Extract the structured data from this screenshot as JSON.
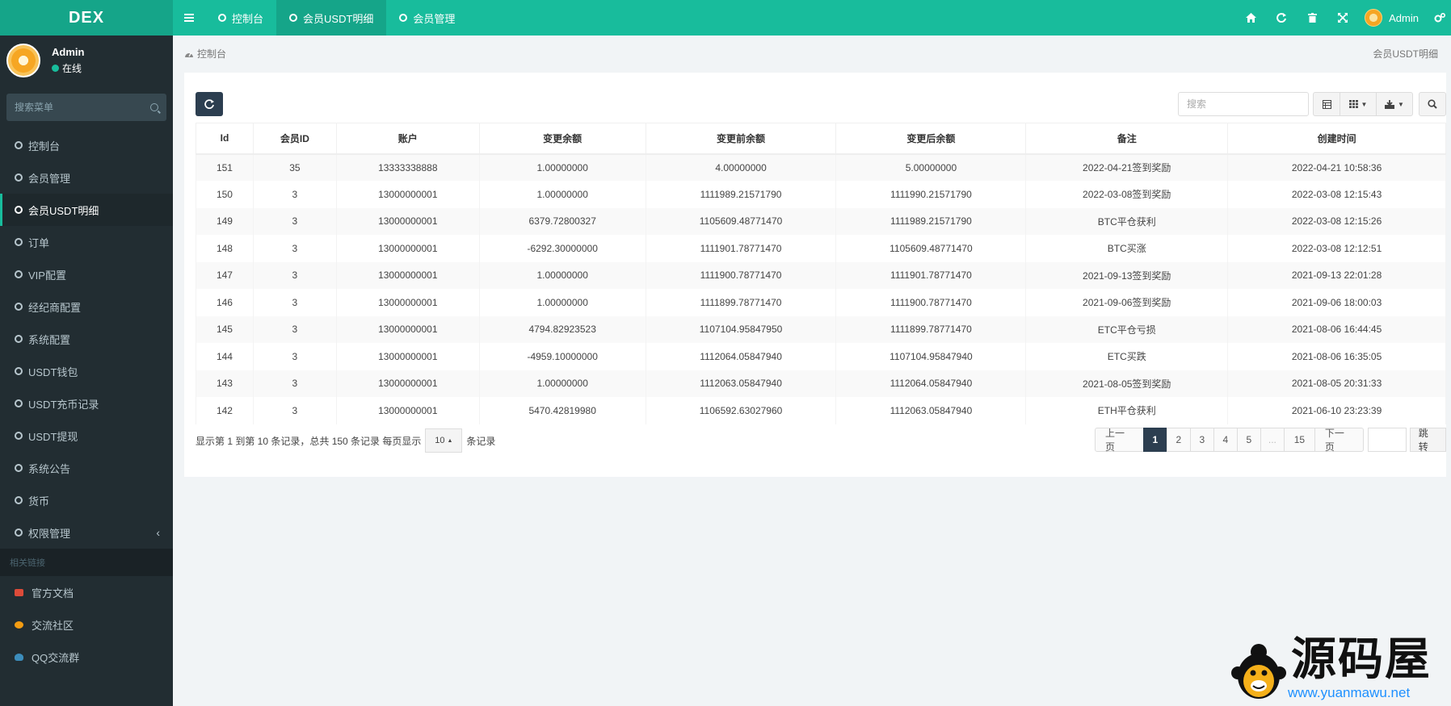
{
  "app": {
    "logo": "DEX"
  },
  "topnav": {
    "tabs": [
      {
        "label": "控制台",
        "active": false
      },
      {
        "label": "会员USDT明细",
        "active": true
      },
      {
        "label": "会员管理",
        "active": false
      }
    ],
    "user": "Admin",
    "icons": [
      "home-icon",
      "refresh-icon",
      "trash-icon",
      "fullscreen-icon",
      "settings-icon"
    ]
  },
  "sidebar": {
    "user_name": "Admin",
    "user_status": "在线",
    "search_placeholder": "搜索菜单",
    "items": [
      {
        "label": "控制台"
      },
      {
        "label": "会员管理"
      },
      {
        "label": "会员USDT明细",
        "active": true
      },
      {
        "label": "订单"
      },
      {
        "label": "VIP配置"
      },
      {
        "label": "经纪商配置"
      },
      {
        "label": "系统配置"
      },
      {
        "label": "USDT钱包"
      },
      {
        "label": "USDT充币记录"
      },
      {
        "label": "USDT提现"
      },
      {
        "label": "系统公告"
      },
      {
        "label": "货币"
      },
      {
        "label": "权限管理",
        "has_children": true
      }
    ],
    "links_header": "相关链接",
    "links": [
      {
        "label": "官方文档",
        "color": "#dd4b39"
      },
      {
        "label": "交流社区",
        "color": "#f39c12"
      },
      {
        "label": "QQ交流群",
        "color": "#3c8dbc"
      }
    ]
  },
  "breadcrumb": {
    "home": "控制台",
    "current": "会员USDT明细"
  },
  "toolbar": {
    "search_placeholder": "搜索"
  },
  "table": {
    "columns": [
      "Id",
      "会员ID",
      "账户",
      "变更余额",
      "变更前余额",
      "变更后余额",
      "备注",
      "创建时间"
    ],
    "rows": [
      [
        "151",
        "35",
        "13333338888",
        "1.00000000",
        "4.00000000",
        "5.00000000",
        "2022-04-21签到奖励",
        "2022-04-21 10:58:36"
      ],
      [
        "150",
        "3",
        "13000000001",
        "1.00000000",
        "1111989.21571790",
        "1111990.21571790",
        "2022-03-08签到奖励",
        "2022-03-08 12:15:43"
      ],
      [
        "149",
        "3",
        "13000000001",
        "6379.72800327",
        "1105609.48771470",
        "1111989.21571790",
        "BTC平仓获利",
        "2022-03-08 12:15:26"
      ],
      [
        "148",
        "3",
        "13000000001",
        "-6292.30000000",
        "1111901.78771470",
        "1105609.48771470",
        "BTC买涨",
        "2022-03-08 12:12:51"
      ],
      [
        "147",
        "3",
        "13000000001",
        "1.00000000",
        "1111900.78771470",
        "1111901.78771470",
        "2021-09-13签到奖励",
        "2021-09-13 22:01:28"
      ],
      [
        "146",
        "3",
        "13000000001",
        "1.00000000",
        "1111899.78771470",
        "1111900.78771470",
        "2021-09-06签到奖励",
        "2021-09-06 18:00:03"
      ],
      [
        "145",
        "3",
        "13000000001",
        "4794.82923523",
        "1107104.95847950",
        "1111899.78771470",
        "ETC平仓亏损",
        "2021-08-06 16:44:45"
      ],
      [
        "144",
        "3",
        "13000000001",
        "-4959.10000000",
        "1112064.05847940",
        "1107104.95847940",
        "ETC买跌",
        "2021-08-06 16:35:05"
      ],
      [
        "143",
        "3",
        "13000000001",
        "1.00000000",
        "1112063.05847940",
        "1112064.05847940",
        "2021-08-05签到奖励",
        "2021-08-05 20:31:33"
      ],
      [
        "142",
        "3",
        "13000000001",
        "5470.42819980",
        "1106592.63027960",
        "1112063.05847940",
        "ETH平仓获利",
        "2021-06-10 23:23:39"
      ]
    ]
  },
  "pagination": {
    "info": "显示第 1 到第 10 条记录，总共 150 条记录 每页显示",
    "page_size": "10",
    "suffix": "条记录",
    "prev": "上一页",
    "pages": [
      "1",
      "2",
      "3",
      "4",
      "5",
      "...",
      "15"
    ],
    "current": "1",
    "next": "下一页",
    "jump": "跳转"
  },
  "watermark": {
    "text": "源码屋",
    "url": "www.yuanmawu.net"
  }
}
